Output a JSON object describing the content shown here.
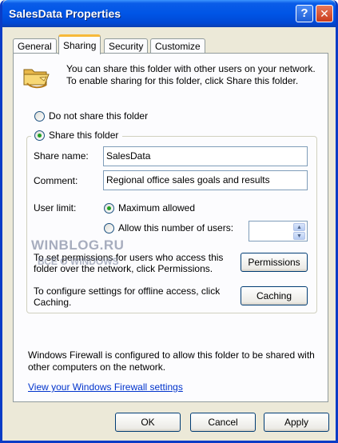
{
  "window": {
    "title": "SalesData Properties",
    "help_glyph": "?",
    "close_glyph": "✕"
  },
  "tabs": [
    {
      "label": "General"
    },
    {
      "label": "Sharing",
      "active": true
    },
    {
      "label": "Security"
    },
    {
      "label": "Customize"
    }
  ],
  "sharing": {
    "intro": "You can share this folder with other users on your network.  To enable sharing for this folder, click Share this folder.",
    "do_not_share_label": "Do not share this folder",
    "share_label": "Share this folder",
    "share_name_label": "Share name:",
    "share_name_value": "SalesData",
    "comment_label": "Comment:",
    "comment_value": "Regional office sales goals and results",
    "user_limit_label": "User limit:",
    "max_allowed_label": "Maximum allowed",
    "allow_number_label": "Allow this number of users:",
    "allow_number_value": "",
    "permissions_text": "To set permissions for users who access this folder over the network, click Permissions.",
    "permissions_button": "Permissions",
    "caching_text": "To configure settings for offline access, click Caching.",
    "caching_button": "Caching",
    "firewall_text": "Windows Firewall is configured to allow this folder to be shared with other computers on the network.",
    "firewall_link": "View your Windows Firewall settings",
    "selected_share_option": "share",
    "selected_user_limit": "maximum"
  },
  "footer": {
    "ok": "OK",
    "cancel": "Cancel",
    "apply": "Apply"
  },
  "watermark": {
    "main": "WINBLOG.RU",
    "sub": "ВСЁ О WINDOWS"
  },
  "colors": {
    "title_bar": "#0055e6",
    "active_tab_accent": "#f7b93a",
    "dialog_bg": "#ece9d8",
    "link": "#0033cc"
  },
  "icons": {
    "folder": "shared-folder-icon",
    "spin_up": "spin-up-icon",
    "spin_down": "spin-down-icon"
  }
}
